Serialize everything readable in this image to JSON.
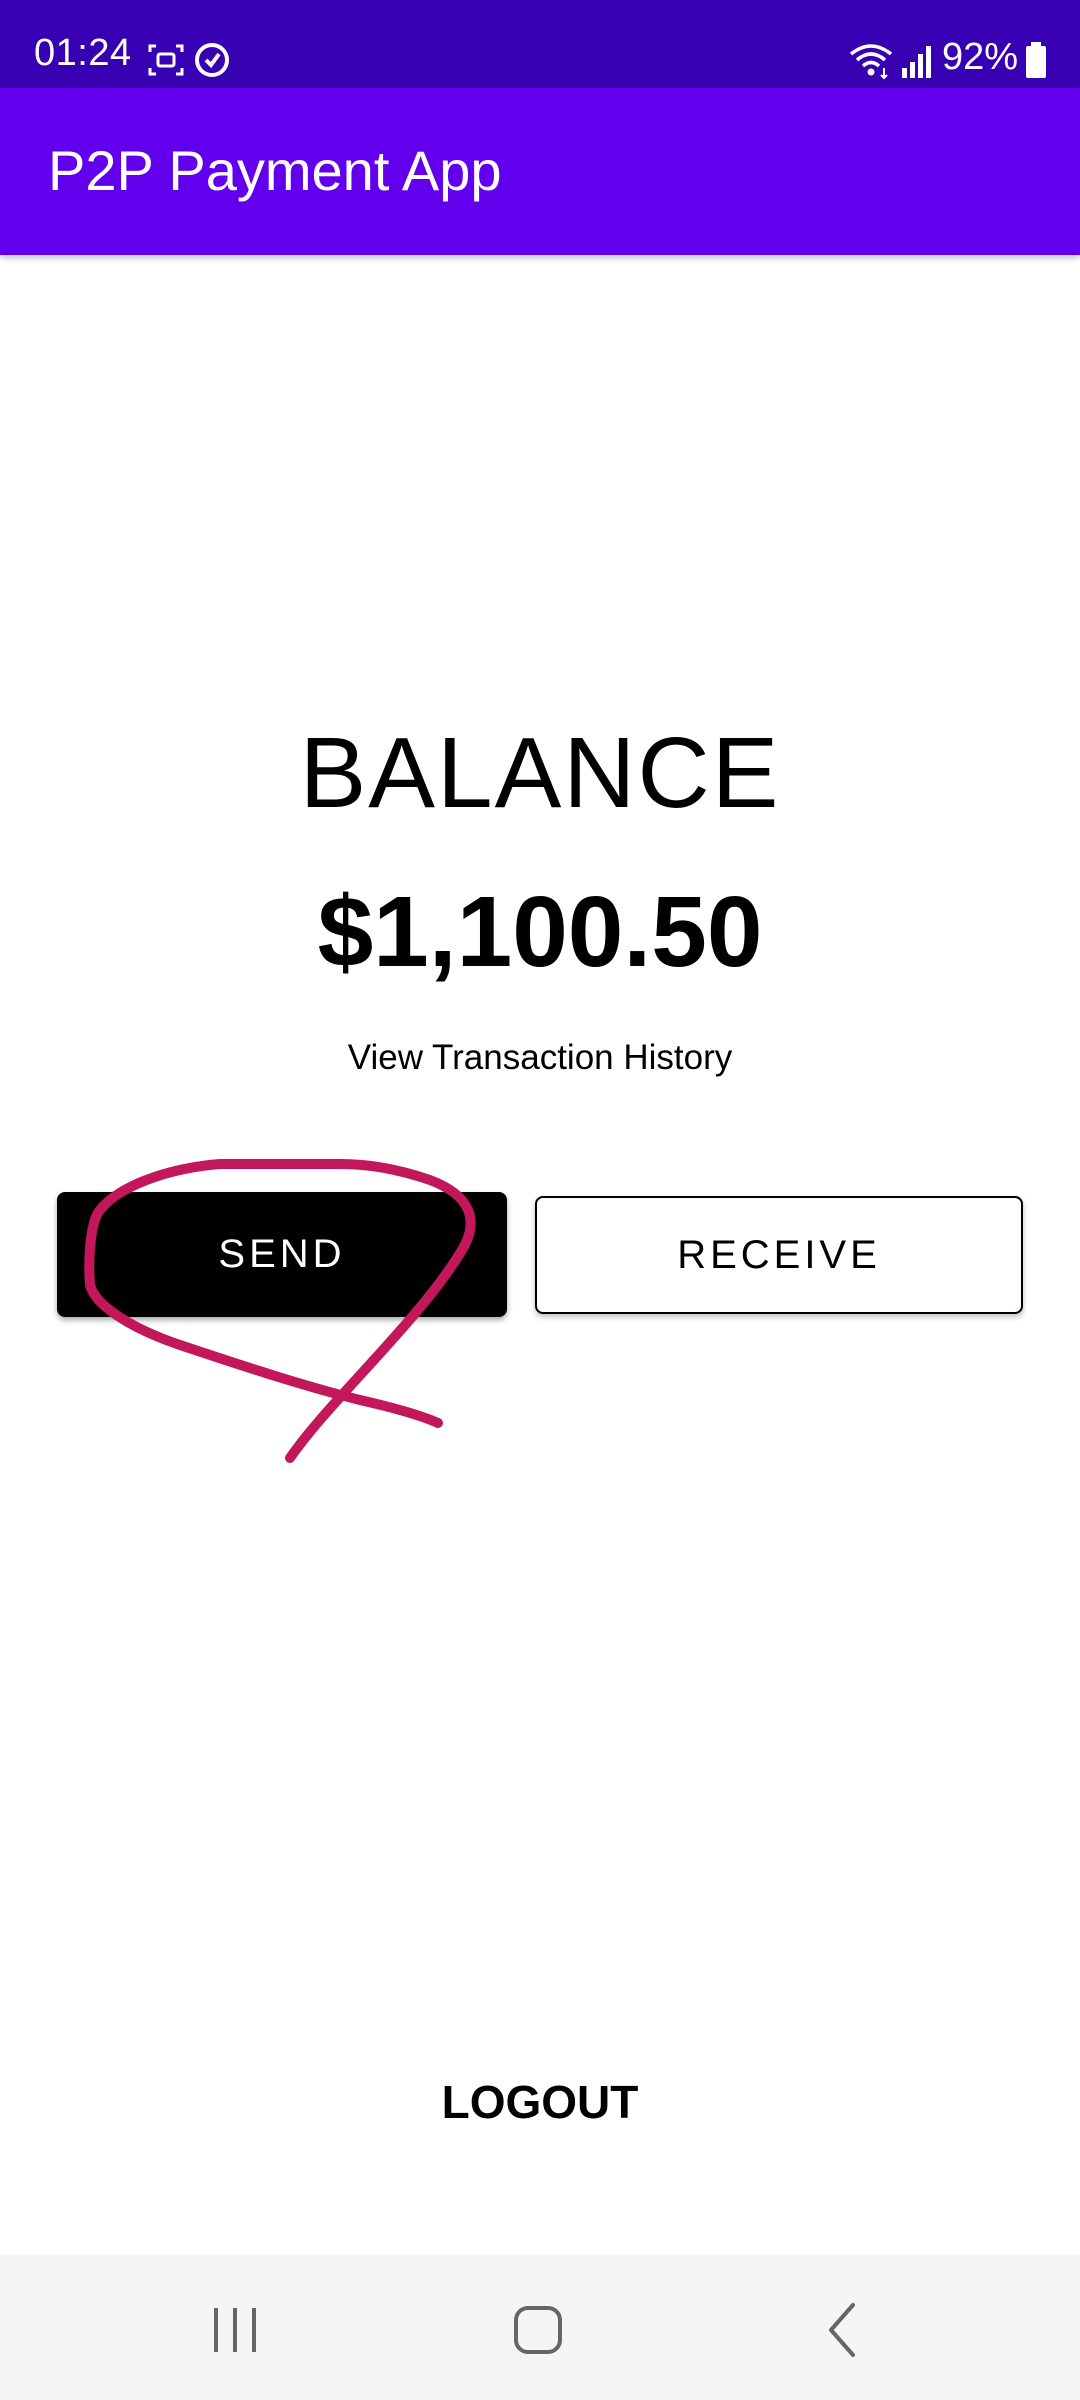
{
  "status_bar": {
    "time": "01:24",
    "battery_percent": "92%",
    "icons": [
      "screenshot-icon",
      "sync-icon",
      "wifi-icon",
      "signal-icon",
      "battery-icon"
    ]
  },
  "app_bar": {
    "title": "P2P Payment App"
  },
  "main": {
    "balance_label": "BALANCE",
    "balance_amount": "$1,100.50",
    "history_link": "View Transaction History",
    "send_label": "SEND",
    "receive_label": "RECEIVE",
    "logout_label": "LOGOUT"
  },
  "nav_bar": {
    "icons": [
      "recents-icon",
      "home-icon",
      "back-icon"
    ]
  },
  "colors": {
    "status_bar": "#3700B3",
    "app_bar": "#6200EE",
    "annotation_stroke": "#C2185B",
    "nav_bar": "#F5F5F5"
  }
}
